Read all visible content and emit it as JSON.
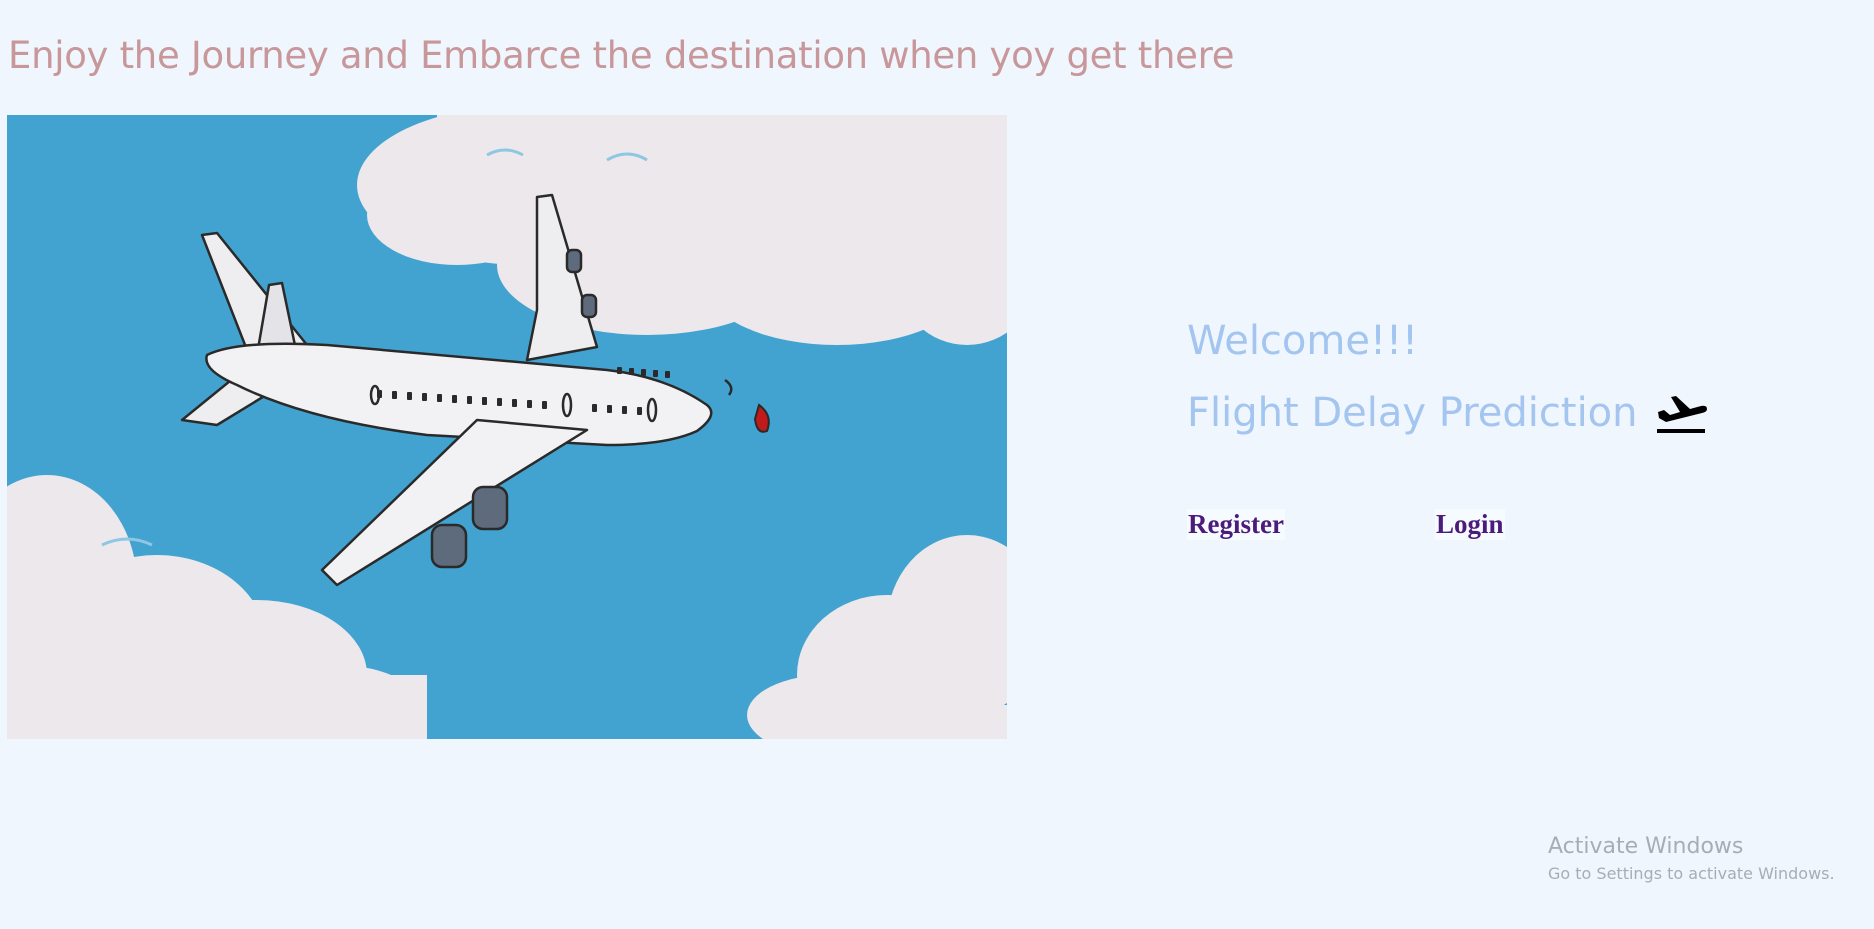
{
  "header": {
    "tagline": "Enjoy the Journey and Embarce the destination when yoy get there"
  },
  "hero": {
    "image_subject": "cartoon airplane flying through clouds",
    "sky_color": "#43a3d0"
  },
  "intro": {
    "welcome": "Welcome!!!",
    "title": "Flight Delay Prediction",
    "title_icon": "airplane-takeoff-icon"
  },
  "nav": {
    "register_label": "Register",
    "login_label": "Login"
  },
  "watermark": {
    "title": "Activate Windows",
    "subtitle": "Go to Settings to activate Windows."
  },
  "colors": {
    "background": "#eff6fe",
    "tagline": "#c8979a",
    "intro_text": "#a3c5ef",
    "nav_links": "#4b1c7c"
  }
}
